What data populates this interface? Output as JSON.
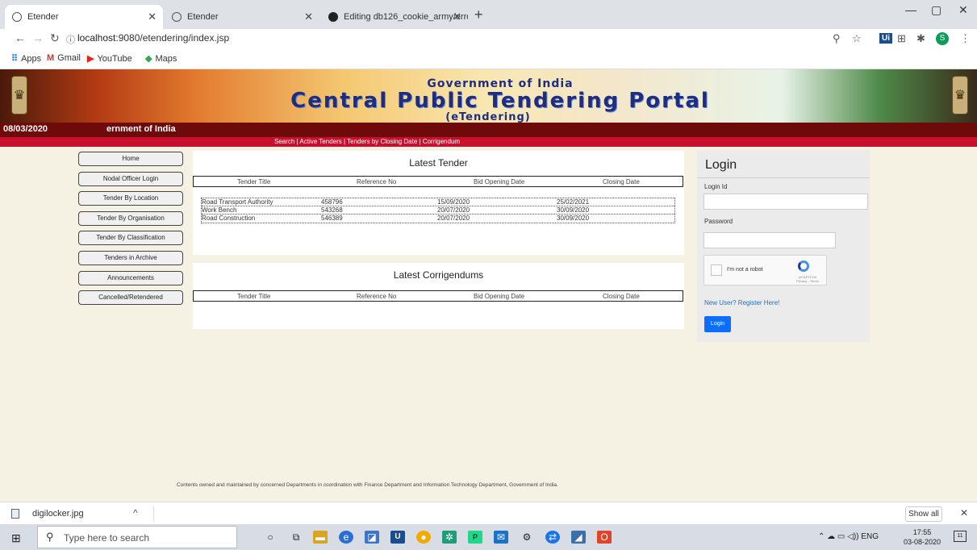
{
  "browser": {
    "tabs": [
      {
        "label": "Etender"
      },
      {
        "label": "Etender"
      },
      {
        "label": "Editing db126_cookie_army/erro"
      }
    ],
    "new_tab": "+",
    "url_prefix": "localhost",
    "url_rest": ":9080/etendering/index.jsp",
    "bookmarks": [
      {
        "label": "Apps"
      },
      {
        "label": "Gmail"
      },
      {
        "label": "YouTube"
      },
      {
        "label": "Maps"
      }
    ],
    "extension_ui": "Ui",
    "profile_initial": "S"
  },
  "banner": {
    "subtitle": "Government of India",
    "title": "Central Public Tendering Portal",
    "tag": "(eTendering)"
  },
  "header": {
    "date": "08/03/2020",
    "marquee": "ernment of India",
    "subnav": "Search | Active Tenders | Tenders by Closing Date | Corrigendum"
  },
  "sidebar": {
    "items": [
      {
        "label": "Home"
      },
      {
        "label": "Nodal Officer Login"
      },
      {
        "label": "Tender By Location"
      },
      {
        "label": "Tender By Organisation"
      },
      {
        "label": "Tender By Classification"
      },
      {
        "label": "Tenders in Archive"
      },
      {
        "label": "Announcements"
      },
      {
        "label": "Cancelled/Retendered"
      }
    ]
  },
  "latest_tender": {
    "title": "Latest Tender",
    "columns": [
      "Tender Title",
      "Reference No",
      "Bid Opening Date",
      "Closing Date"
    ],
    "rows": [
      [
        "Road Transport Authority",
        "458796",
        "15/09/2020",
        "25/02/2021"
      ],
      [
        "Work Bench",
        "543268",
        "20/07/2020",
        "30/09/2020"
      ],
      [
        "Road Construction",
        "546389",
        "20/07/2020",
        "30/09/2020"
      ]
    ]
  },
  "latest_corrigendums": {
    "title": "Latest Corrigendums",
    "columns": [
      "Tender Title",
      "Reference No",
      "Bid Opening Date",
      "Closing Date"
    ]
  },
  "login": {
    "title": "Login",
    "login_id_label": "Login Id",
    "password_label": "Password",
    "captcha_text": "I'm not a robot",
    "captcha_brand": "reCAPTCHA",
    "captcha_links": "Privacy - Terms",
    "register_link": "New User? Register Here!",
    "button": "Login"
  },
  "footer": {
    "text": "Contents owned and maintained by concerned Departments in coordination with Finance Department and Information Technology Department, Government of India."
  },
  "downloads": {
    "file": "digilocker.jpg",
    "show_all": "Show all"
  },
  "taskbar": {
    "search_placeholder": "Type here to search",
    "tray_lang": "ENG",
    "time": "17:55",
    "date": "03-08-2020",
    "notifications": "11"
  }
}
